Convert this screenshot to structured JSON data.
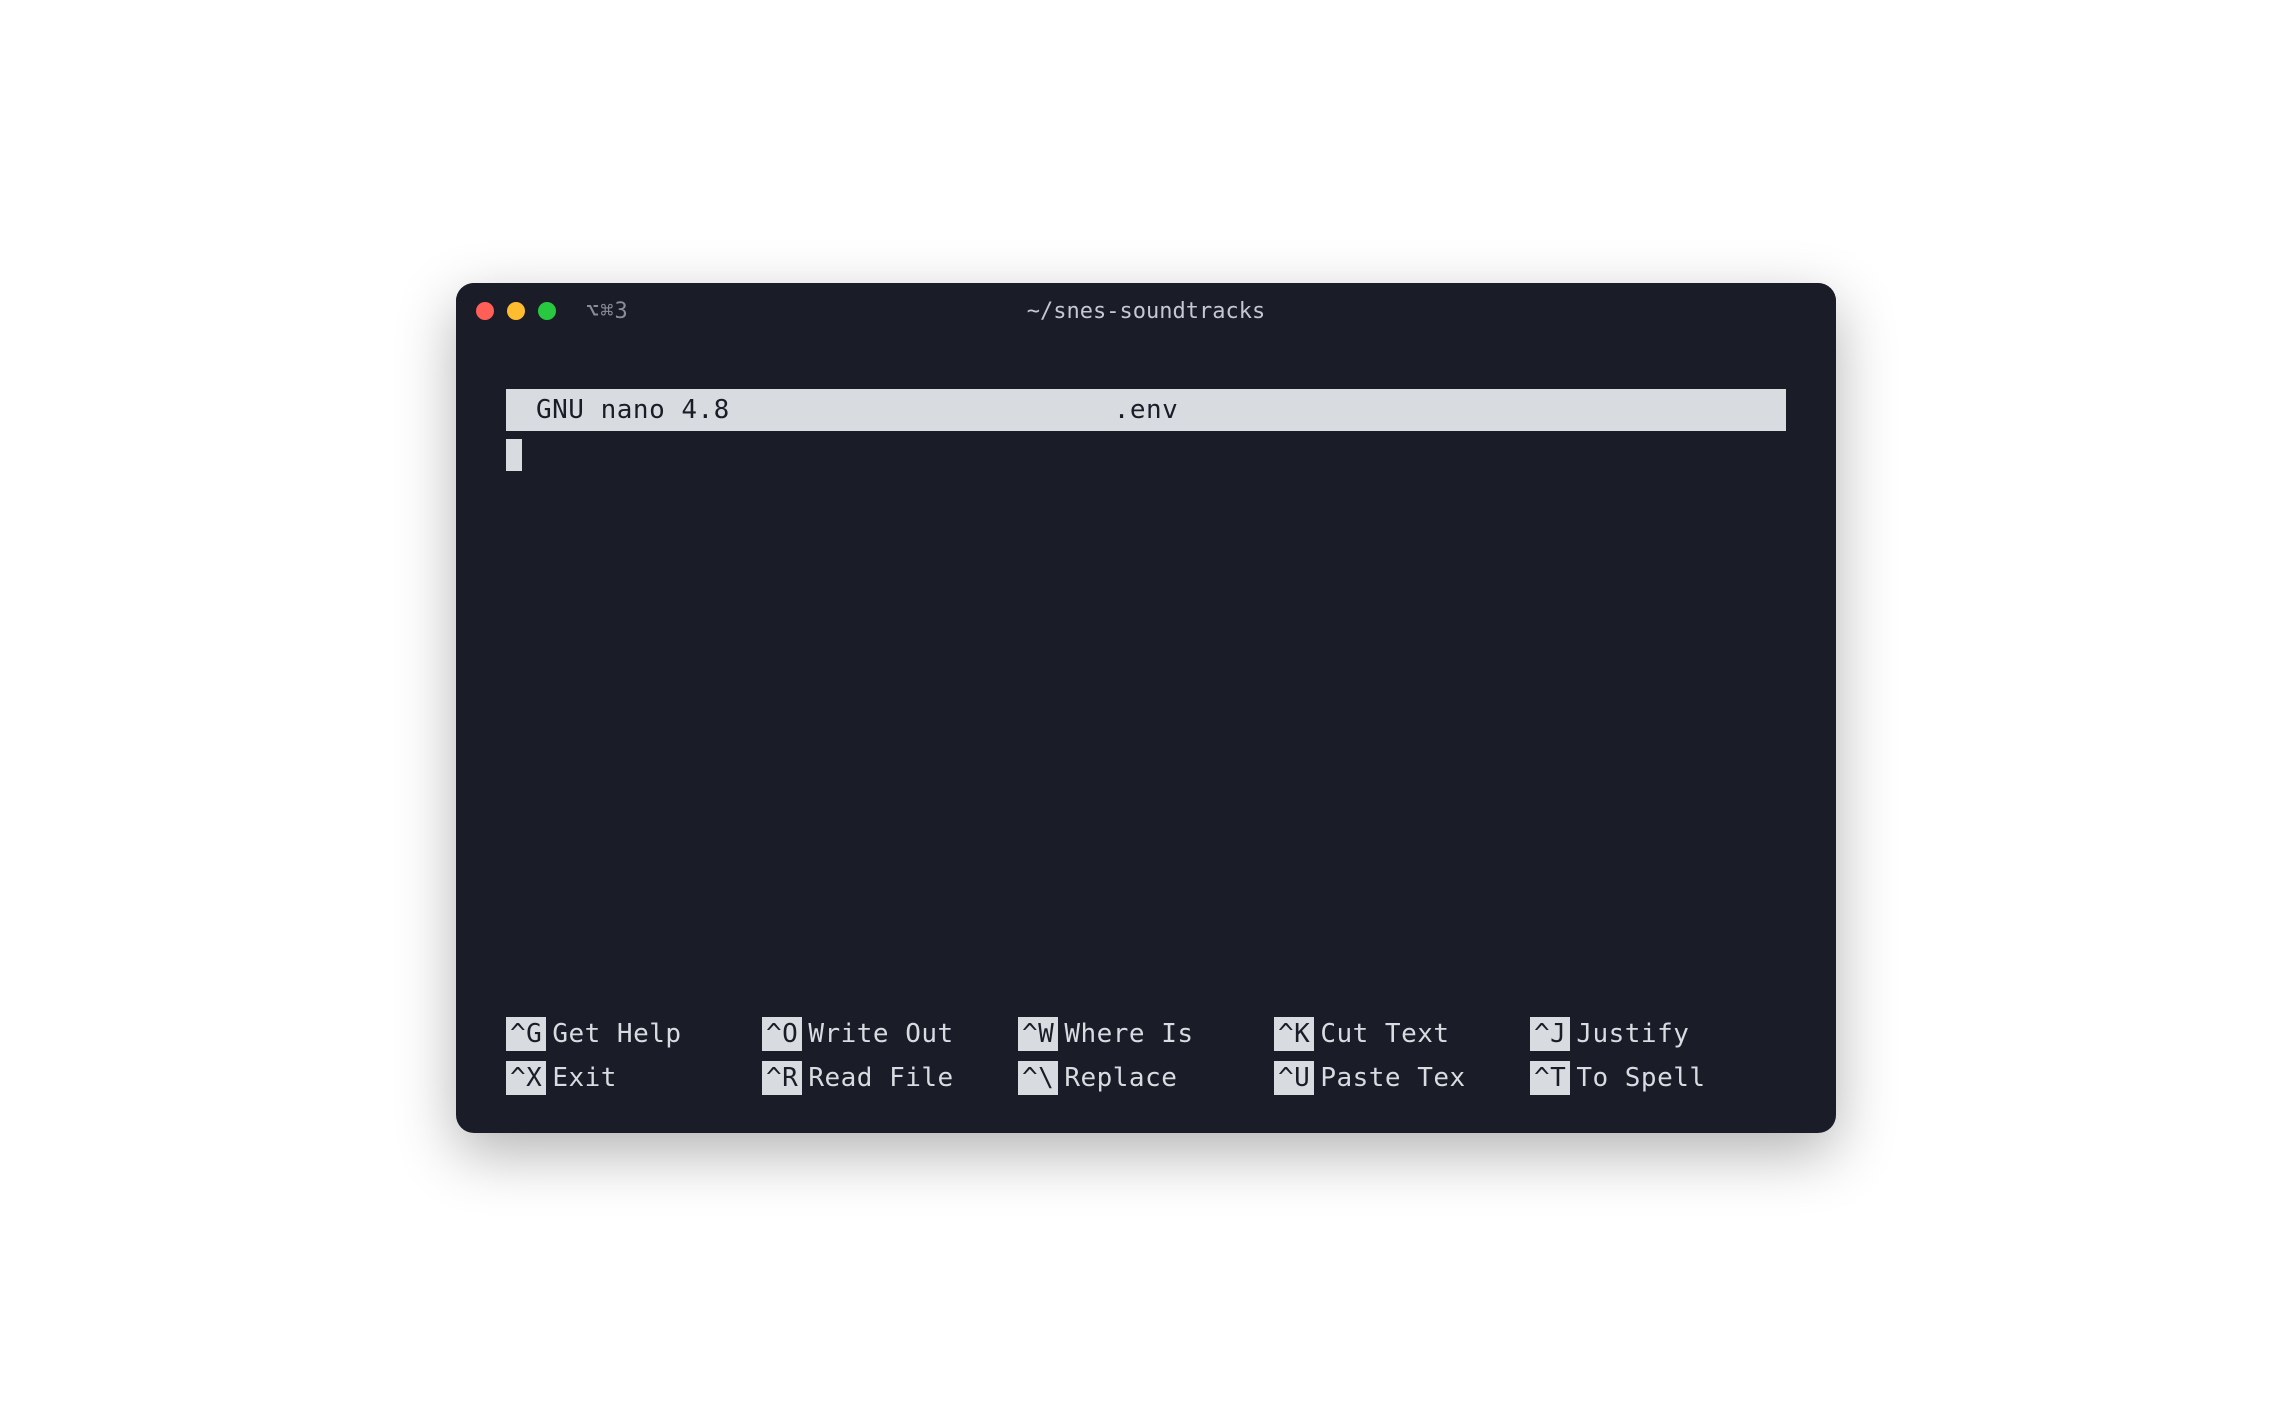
{
  "titlebar": {
    "tab_indicator": "⌥⌘3",
    "title": "~/snes-soundtracks"
  },
  "nano": {
    "app_name": "GNU nano 4.8",
    "file_name": ".env"
  },
  "shortcuts": {
    "row1": [
      {
        "key": "^G",
        "label": "Get Help"
      },
      {
        "key": "^O",
        "label": "Write Out"
      },
      {
        "key": "^W",
        "label": "Where Is"
      },
      {
        "key": "^K",
        "label": "Cut Text"
      },
      {
        "key": "^J",
        "label": "Justify"
      }
    ],
    "row2": [
      {
        "key": "^X",
        "label": "Exit"
      },
      {
        "key": "^R",
        "label": "Read File"
      },
      {
        "key": "^\\",
        "label": "Replace"
      },
      {
        "key": "^U",
        "label": "Paste Tex"
      },
      {
        "key": "^T",
        "label": "To Spell"
      }
    ]
  }
}
